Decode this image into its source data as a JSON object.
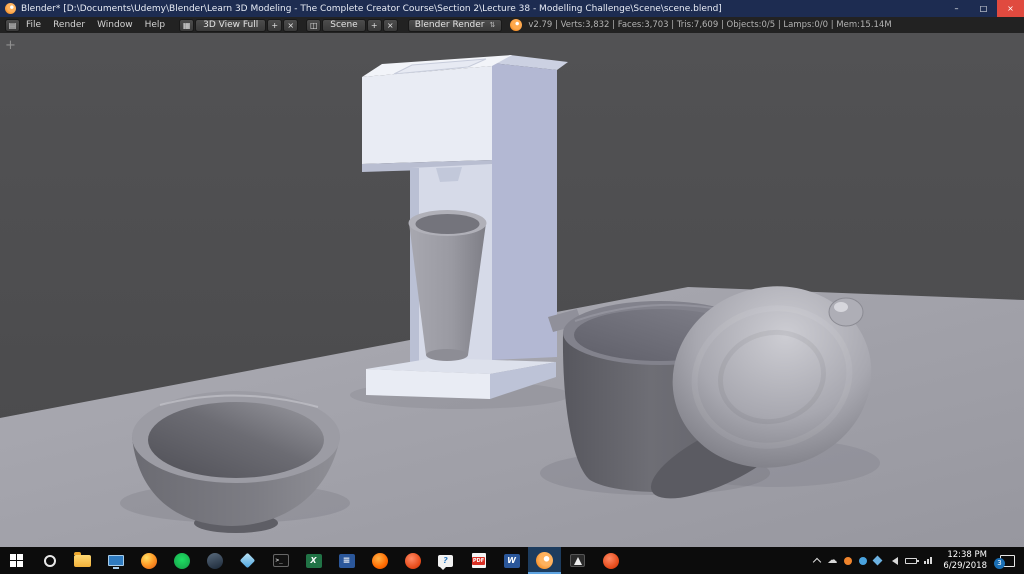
{
  "colors": {
    "titlebar_bg": "#1d2c51",
    "close_red": "#e04a3f",
    "header_bg": "#222222",
    "viewport_bg": "#4e4e50",
    "floor_gray": "#a5a5ad",
    "taskbar_bg": "#0c0c0c",
    "accent_blue": "#5ea3e0",
    "blender_orange": "#ef7600"
  },
  "titlebar": {
    "title": "Blender* [D:\\Documents\\Udemy\\Blender\\Learn 3D Modeling - The Complete Creator Course\\Section 2\\Lecture 38 - Modelling Challenge\\Scene\\scene.blend]",
    "minimize_glyph": "–",
    "maximize_glyph": "□",
    "close_glyph": "×"
  },
  "header": {
    "menus": [
      "File",
      "Render",
      "Window",
      "Help"
    ],
    "layout_name": "3D View Full",
    "scene_name": "Scene",
    "render_engine": "Blender Render",
    "add_label": "+",
    "close_x_label": "×",
    "stats": "v2.79 | Verts:3,832 | Faces:3,703 | Tris:7,609 | Objects:0/5 | Lamps:0/0 | Mem:15.14M"
  },
  "icons": {
    "editor_type_glyph": "▤",
    "layout_browse_glyph": "▦",
    "scene_browse_glyph": "◫",
    "engine_arrows_glyph": "⇅",
    "viewport_add_glyph": "+",
    "terminal_glyph": ">_",
    "excel_glyph": "X",
    "notes_glyph": "≡",
    "question_glyph": "?",
    "pdf_glyph": "PDF",
    "word_glyph": "W"
  },
  "taskbar": {
    "tray_time": "12:38 PM",
    "tray_date": "6/29/2018",
    "notification_count": "3"
  }
}
